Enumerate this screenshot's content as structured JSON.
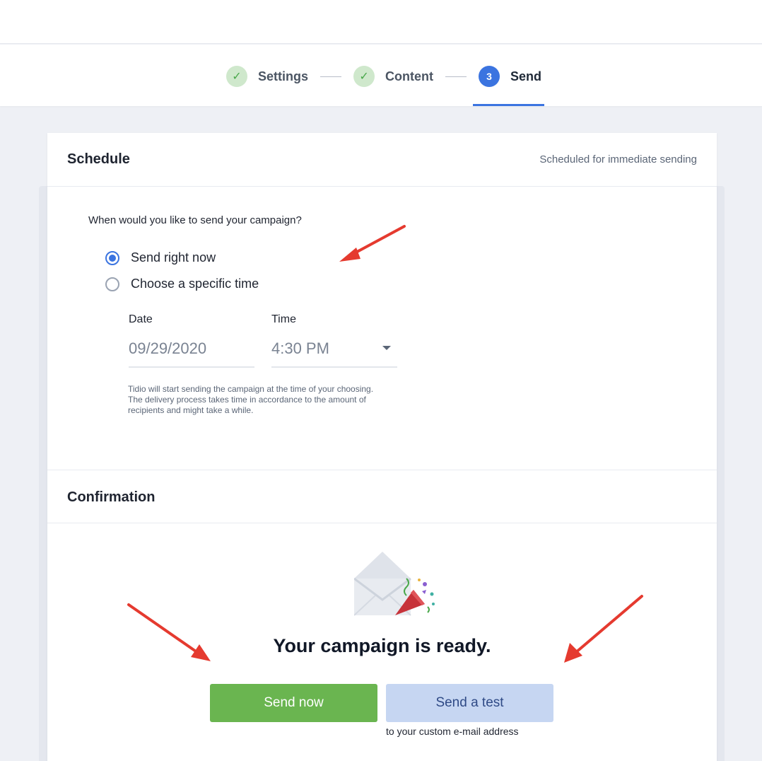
{
  "steps": [
    {
      "label": "Settings",
      "marker": "✓",
      "state": "done"
    },
    {
      "label": "Content",
      "marker": "✓",
      "state": "done"
    },
    {
      "label": "Send",
      "marker": "3",
      "state": "active"
    }
  ],
  "schedule": {
    "title": "Schedule",
    "status_note": "Scheduled for immediate sending",
    "question": "When would you like to send your campaign?",
    "options": [
      {
        "label": "Send right now",
        "checked": true
      },
      {
        "label": "Choose a specific time",
        "checked": false
      }
    ],
    "date_label": "Date",
    "date_value": "09/29/2020",
    "time_label": "Time",
    "time_value": "4:30 PM",
    "help_text": "Tidio will start sending the campaign at the time of your choosing. The delivery process takes time in accordance to the amount of recipients and might take a while."
  },
  "confirmation": {
    "title": "Confirmation",
    "ready_message": "Your campaign is ready.",
    "send_now_label": "Send now",
    "send_test_label": "Send a test",
    "send_test_note": "to your custom e-mail address"
  },
  "colors": {
    "accent": "#3b74e0",
    "success": "#6ab550",
    "secondary_button": "#c6d6f2",
    "annotation_arrow": "#e53a2f"
  },
  "icons": [
    "check-icon",
    "envelope-icon",
    "party-popper-icon",
    "caret-down-icon"
  ]
}
